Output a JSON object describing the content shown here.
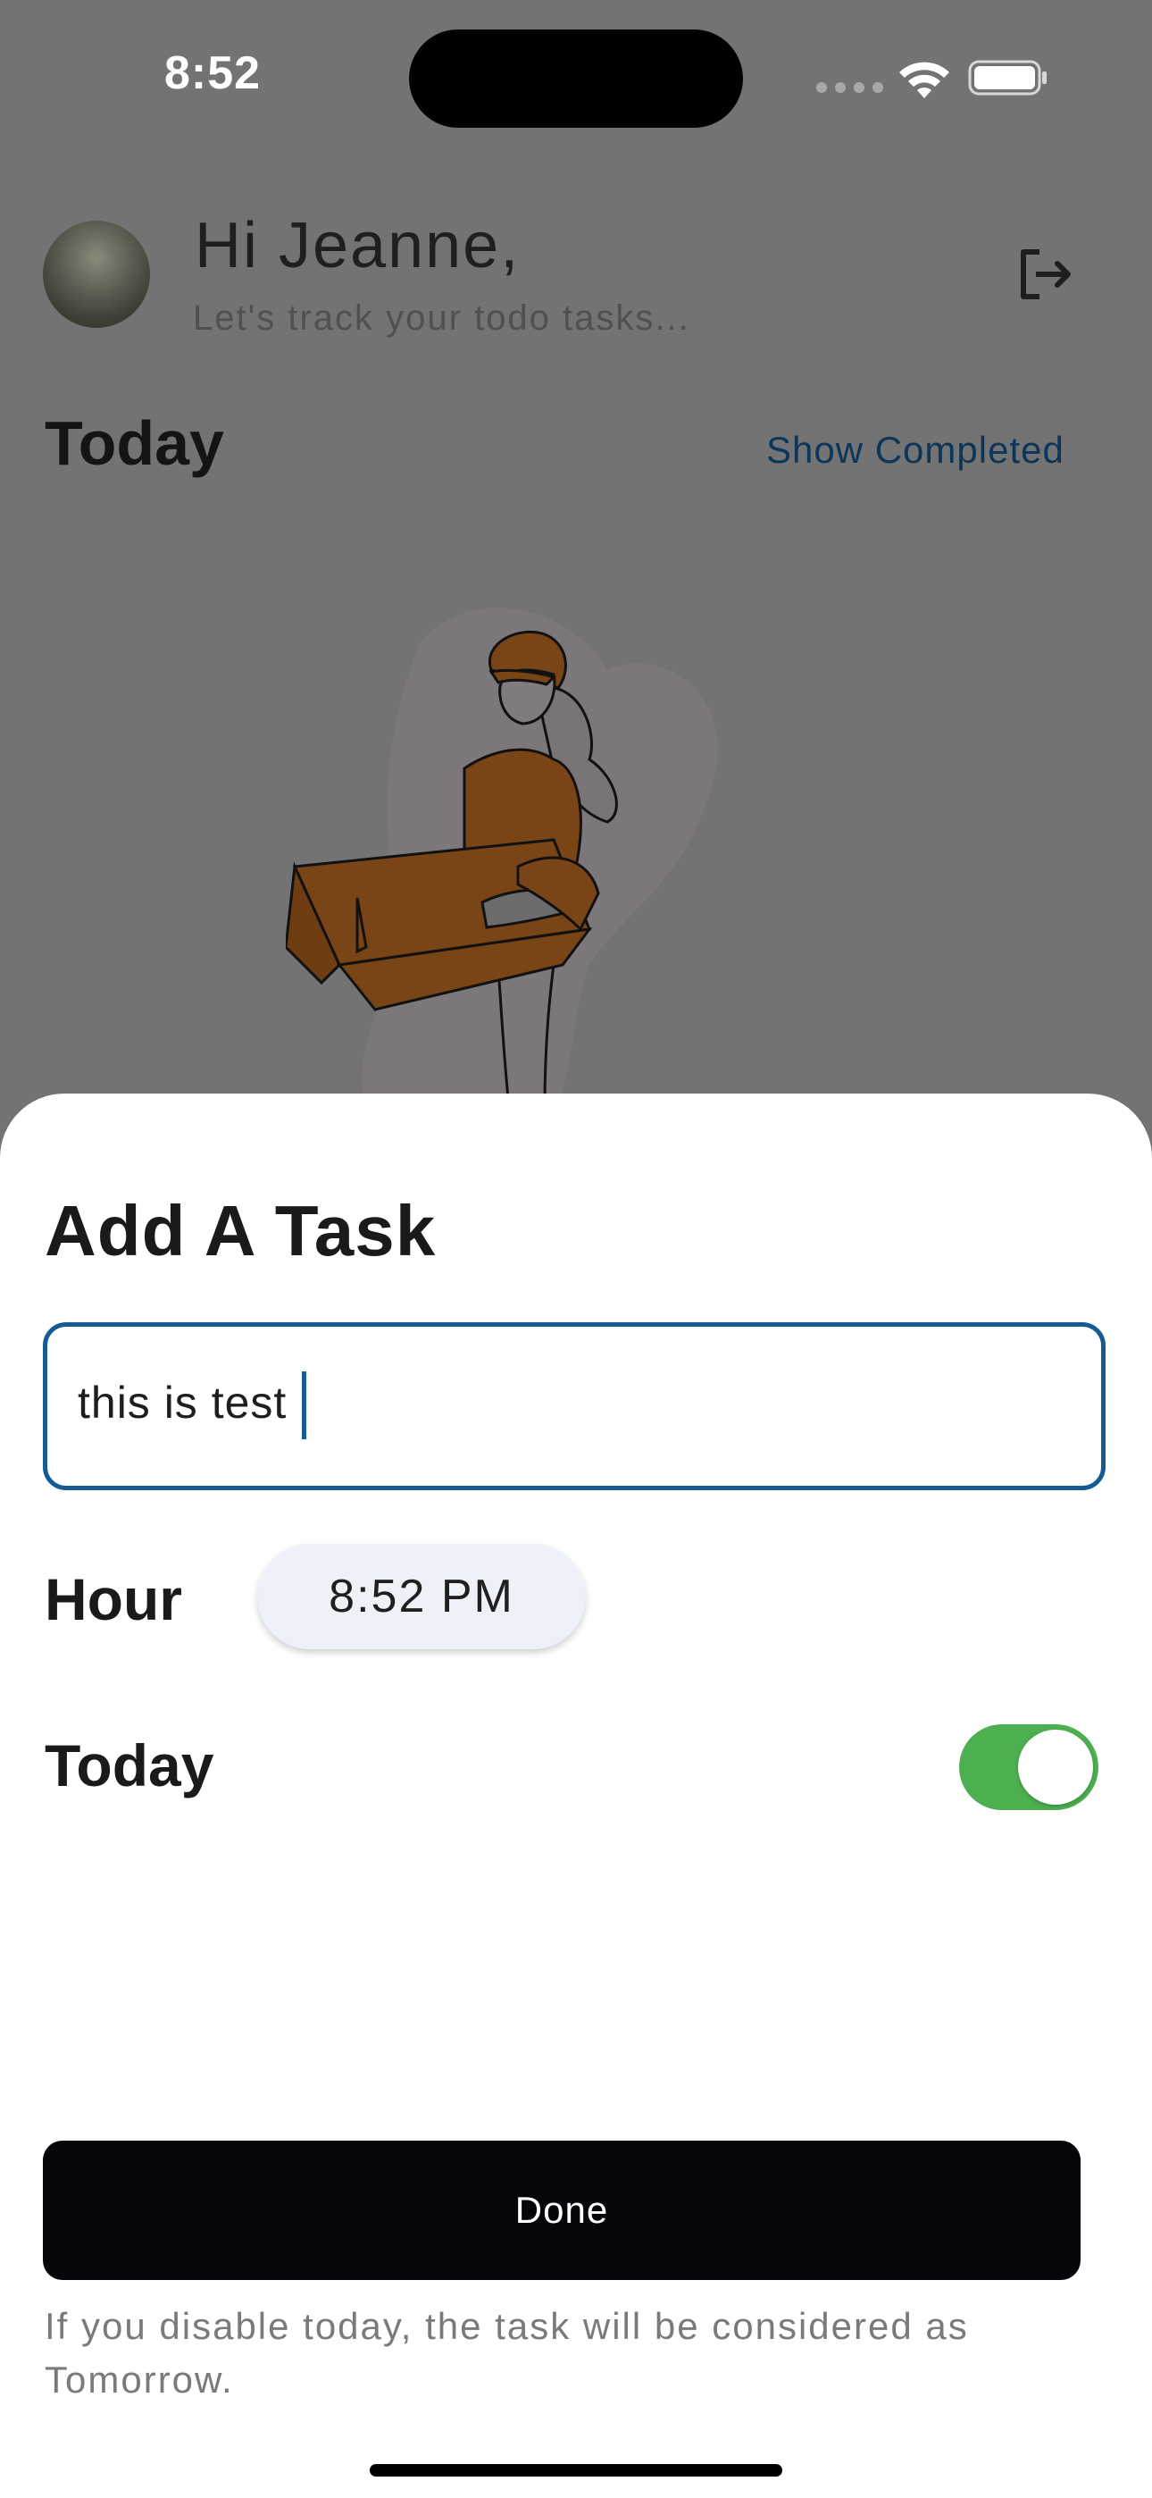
{
  "status_bar": {
    "time": "8:52"
  },
  "header": {
    "greeting": "Hi Jeanne,",
    "subtitle": "Let's track your todo tasks...",
    "logout_icon": "logout-icon"
  },
  "section": {
    "title": "Today",
    "show_completed_label": "Show Completed"
  },
  "sheet": {
    "title": "Add A Task",
    "task_input_value": "this is test",
    "hour_label": "Hour",
    "hour_value": "8:52 PM",
    "today_label": "Today",
    "today_enabled": true,
    "done_label": "Done",
    "hint": "If you disable today, the task will be considered as Tomorrow."
  },
  "colors": {
    "accent": "#145a93",
    "toggle_on": "#4caf50",
    "button_bg": "#04060a",
    "overlay": "#737373"
  }
}
